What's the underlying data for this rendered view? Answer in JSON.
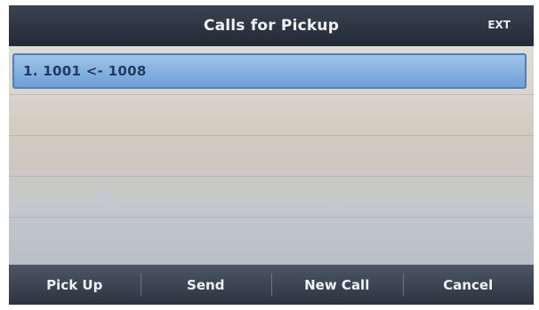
{
  "header": {
    "title": "Calls for Pickup",
    "status_indicator": "EXT"
  },
  "calls": [
    {
      "label": "1. 1001 <- 1008"
    }
  ],
  "softkeys": [
    {
      "label": "Pick Up"
    },
    {
      "label": "Send"
    },
    {
      "label": "New Call"
    },
    {
      "label": "Cancel"
    }
  ],
  "colors": {
    "title_bar": "#2c3440",
    "selection_highlight": "#7faadd",
    "softkey_bar": "#3a4452"
  }
}
